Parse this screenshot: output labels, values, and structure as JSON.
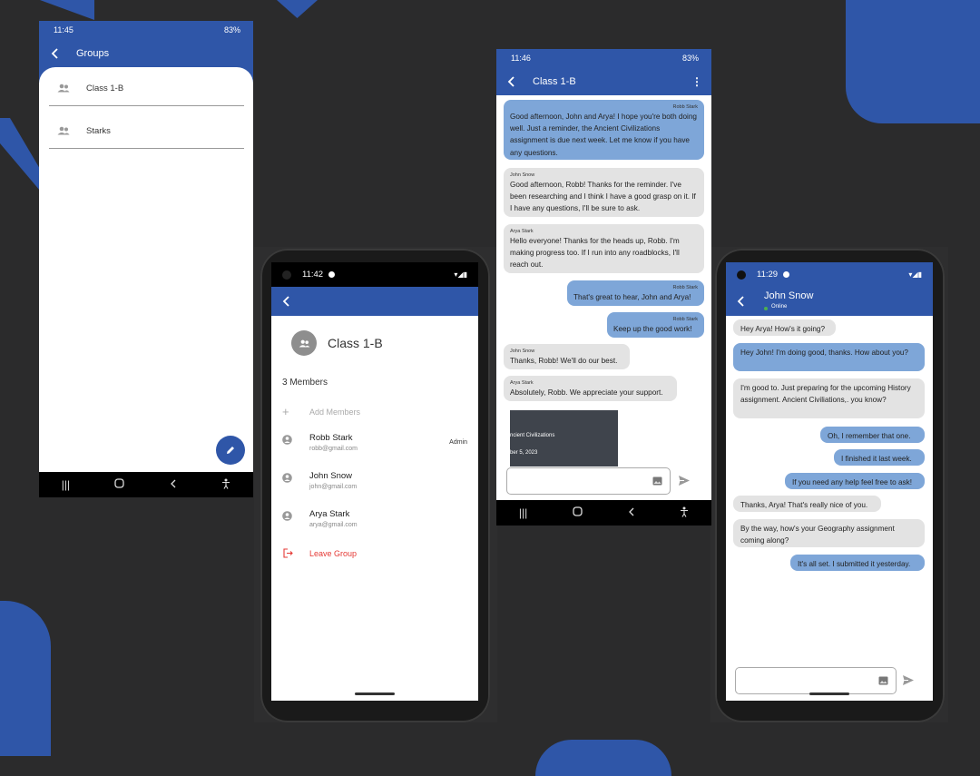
{
  "colors": {
    "accent": "#2f56a8",
    "bubble_me": "#7ea6d8",
    "bubble_them": "#e3e3e3",
    "danger": "#e53935",
    "online": "#4caf50"
  },
  "groups_screen": {
    "status_time": "11:45",
    "status_battery": "83%",
    "title": "Groups",
    "groups": [
      {
        "name": "Class 1-B",
        "icon": "group-icon"
      },
      {
        "name": "Starks",
        "icon": "group-icon"
      }
    ],
    "fab_icon": "pencil-icon"
  },
  "group_info_screen": {
    "status_time": "11:42",
    "group_name": "Class 1-B",
    "members_count_label": "3 Members",
    "add_members_label": "Add Members",
    "members": [
      {
        "name": "Robb Stark",
        "email": "robb@gmail.com",
        "role": "Admin"
      },
      {
        "name": "John Snow",
        "email": "john@gmail.com",
        "role": ""
      },
      {
        "name": "Arya Stark",
        "email": "arya@gmail.com",
        "role": ""
      }
    ],
    "leave_label": "Leave Group"
  },
  "group_chat_screen": {
    "status_time": "11:46",
    "status_battery": "83%",
    "title": "Class 1-B",
    "messages": [
      {
        "sender": "Robb Stark",
        "text": "Good afternoon, John and Arya! I hope you're both doing well. Just a reminder, the Ancient Civilizations assignment is due next week. Let me know if you have any questions.",
        "mine": true
      },
      {
        "sender": "John Snow",
        "text": "Good afternoon, Robb! Thanks for the reminder. I've been researching and I think I have a good grasp on it. If I have any questions, I'll be sure to ask.",
        "mine": false
      },
      {
        "sender": "Arya Stark",
        "text": "Hello everyone! Thanks for the heads up, Robb. I'm making progress too. If I run into any roadblocks, I'll reach out.",
        "mine": false
      },
      {
        "sender": "Robb Stark",
        "text": "That's great to hear, John and Arya!",
        "mine": true
      },
      {
        "sender": "Robb Stark",
        "text": "Keep up the good work!",
        "mine": true
      },
      {
        "sender": "John Snow",
        "text": "Thanks, Robb! We'll do our best.",
        "mine": false
      },
      {
        "sender": "Arya Stark",
        "text": "Absolutely, Robb. We appreciate your support.",
        "mine": false
      }
    ],
    "attachment": {
      "line1": "ncient Civilizations",
      "line2": "ber 5, 2023"
    }
  },
  "direct_chat_screen": {
    "status_time": "11:29",
    "contact_name": "John Snow",
    "contact_status": "Online",
    "messages": [
      {
        "text": "Hey Arya! How's it going?",
        "mine": false
      },
      {
        "text": "Hey John! I'm doing good, thanks. How about you?",
        "mine": true
      },
      {
        "text": "I'm good to. Just preparing for the upcoming History assignment. Ancient Civiliations,. you know?",
        "mine": false
      },
      {
        "text": "Oh, I remember that one.",
        "mine": true
      },
      {
        "text": "I finished it last week.",
        "mine": true
      },
      {
        "text": "If you need any help feel free to ask!",
        "mine": true
      },
      {
        "text": "Thanks, Arya! That's really nice of you.",
        "mine": false
      },
      {
        "text": "By the way, how's your Geography assignment coming along?",
        "mine": false
      },
      {
        "text": "It's all set. I submitted it yesterday.",
        "mine": true
      }
    ]
  }
}
